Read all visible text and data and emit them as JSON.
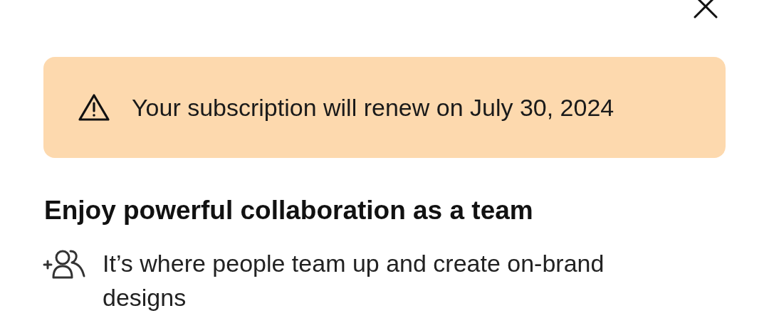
{
  "banner": {
    "kind": "warning",
    "text": "Your subscription will renew on July 30, 2024"
  },
  "heading": "Enjoy powerful collaboration as a team",
  "features": [
    {
      "text": "It’s where people team up and create on-brand designs"
    }
  ]
}
